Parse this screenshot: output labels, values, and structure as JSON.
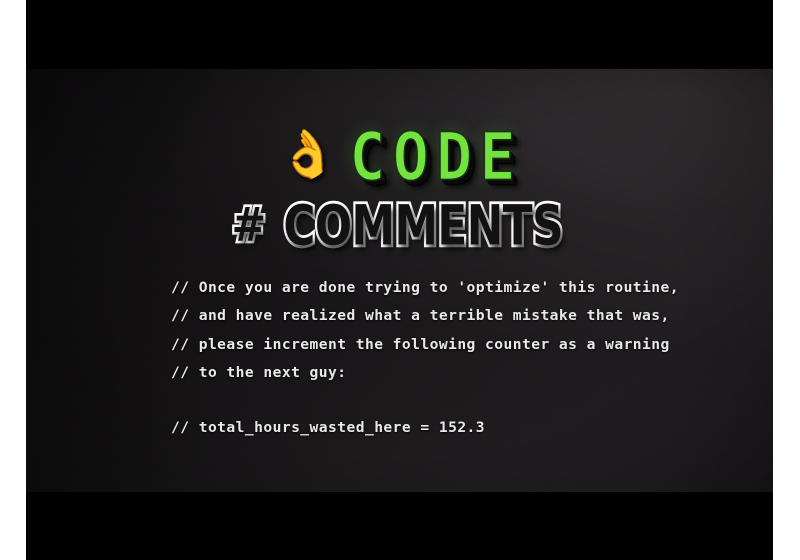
{
  "page": {
    "background_color": "#ffffff"
  },
  "player": {
    "frame_color": "#000000",
    "letterbox": true
  },
  "video": {
    "background_gradient_dark": "#0b0a0b",
    "background_gradient_light": "#262326",
    "title": {
      "emoji": "👌",
      "emoji_name": "ok-hand-emoji",
      "line1_word": "CODE",
      "line1_color": "#73e33d",
      "line2_hash": "#",
      "line2_word": "COMMENTS",
      "line2_fill_color": "#121212",
      "line2_outline_color": "#ffffff"
    },
    "code_comment": {
      "text_color": "#e9e9ea",
      "lines": [
        "// Once you are done trying to 'optimize' this routine,",
        "// and have realized what a terrible mistake that was,",
        "// please increment the following counter as a warning",
        "// to the next guy:",
        "",
        "// total_hours_wasted_here = 152.3"
      ],
      "counter_variable": "total_hours_wasted_here",
      "counter_value": "152.3"
    }
  }
}
